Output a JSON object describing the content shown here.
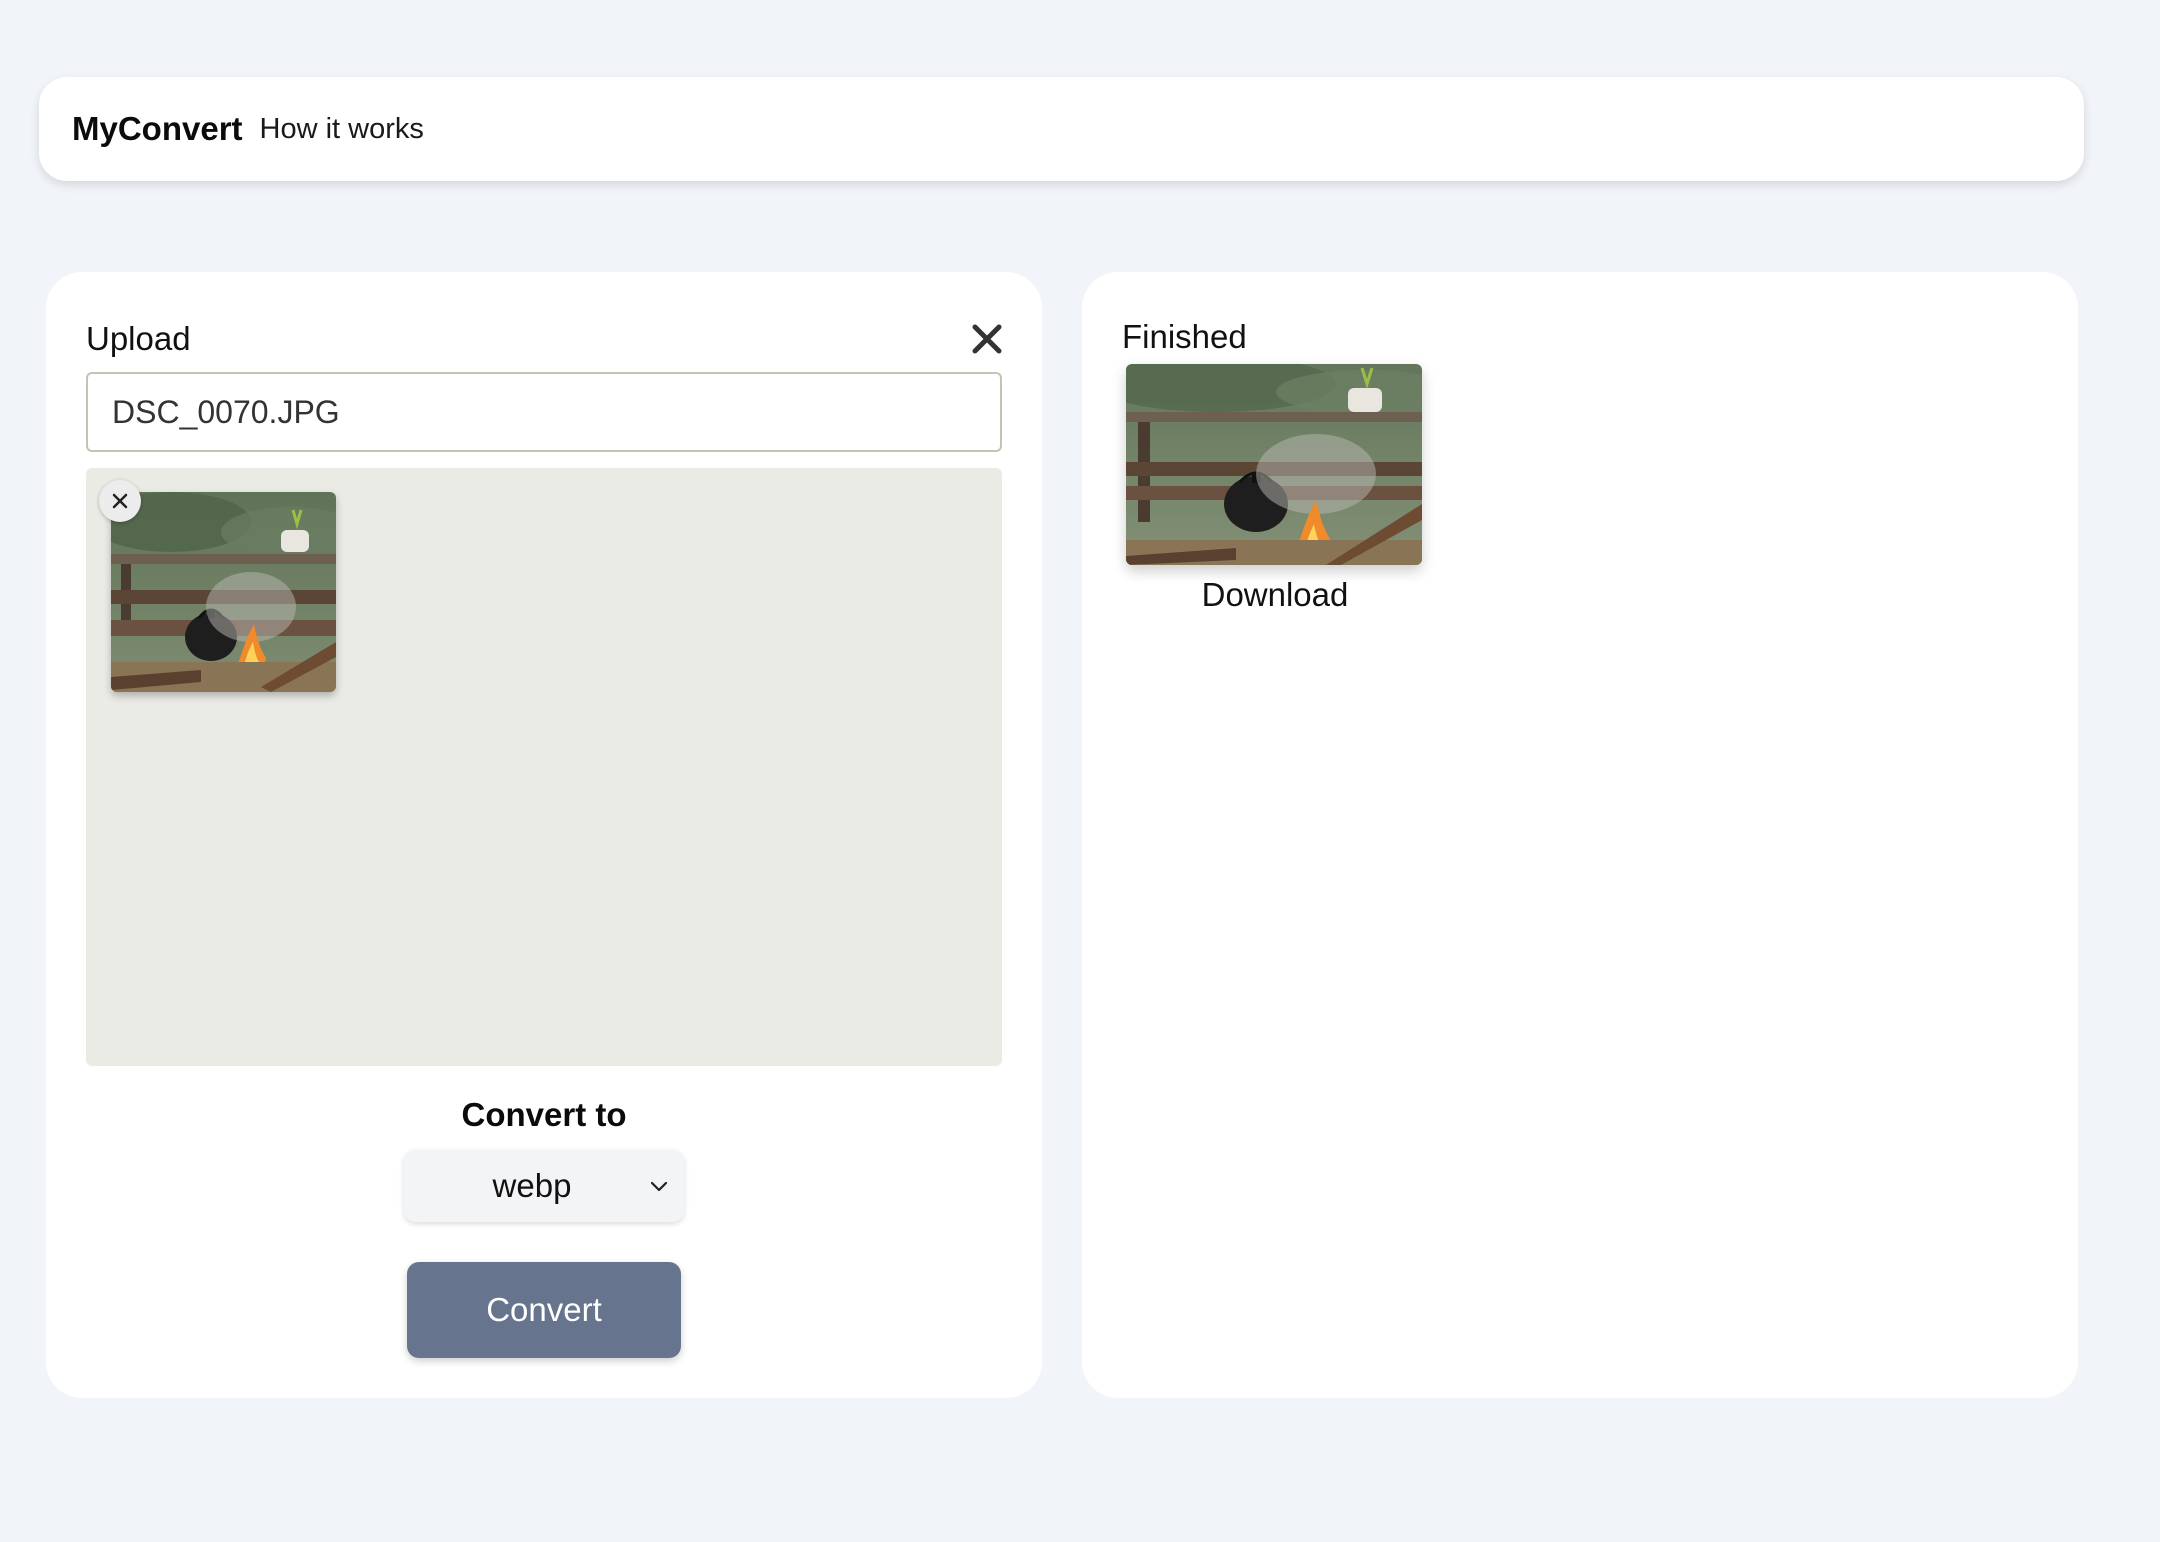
{
  "header": {
    "brand": "MyConvert",
    "nav_link": "How it works"
  },
  "upload": {
    "title": "Upload",
    "filename": "DSC_0070.JPG",
    "close_icon": "close-icon",
    "remove_icon": "close-icon",
    "convert_label": "Convert to",
    "format": {
      "selected": "webp"
    },
    "convert_button": "Convert"
  },
  "finished": {
    "title": "Finished",
    "download_label": "Download"
  },
  "colors": {
    "page_bg": "#f1f4f9",
    "panel_bg": "#ffffff",
    "dropzone_bg": "#ebebe6",
    "button_bg": "#66748e",
    "button_text": "#ffffff"
  }
}
